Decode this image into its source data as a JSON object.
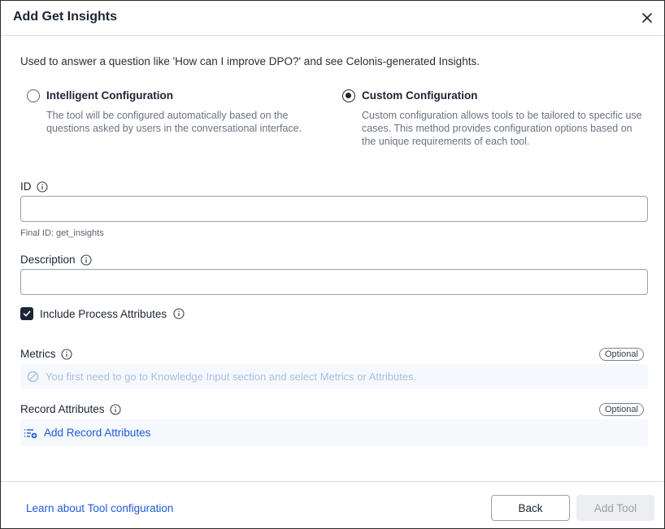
{
  "dialog": {
    "title": "Add Get Insights",
    "intro": "Used to answer a question like 'How can I improve DPO?' and see Celonis-generated Insights."
  },
  "config_options": [
    {
      "label": "Intelligent Configuration",
      "description": "The tool will be configured automatically based on the questions asked by users in the conversational interface.",
      "selected": false
    },
    {
      "label": "Custom Configuration",
      "description": "Custom configuration allows tools to be tailored to specific use cases. This method provides configuration options based on the unique requirements of each tool.",
      "selected": true
    }
  ],
  "id_field": {
    "label": "ID",
    "value": "",
    "hint": "Final ID: get_insights"
  },
  "description_field": {
    "label": "Description",
    "value": ""
  },
  "process_attributes": {
    "label": "Include Process Attributes",
    "checked": true
  },
  "metrics": {
    "label": "Metrics",
    "badge": "Optional",
    "disabled_message": "You first need to go to Knowledge Input section and select Metrics or Attributes."
  },
  "record_attributes": {
    "label": "Record Attributes",
    "badge": "Optional",
    "add_label": "Add Record Attributes"
  },
  "footer": {
    "learn_link": "Learn about Tool configuration",
    "back_label": "Back",
    "add_tool_label": "Add Tool"
  },
  "colors": {
    "link": "#1e5bd8",
    "primary": "#1b2533",
    "disabled_text": "#a9bfdc"
  }
}
